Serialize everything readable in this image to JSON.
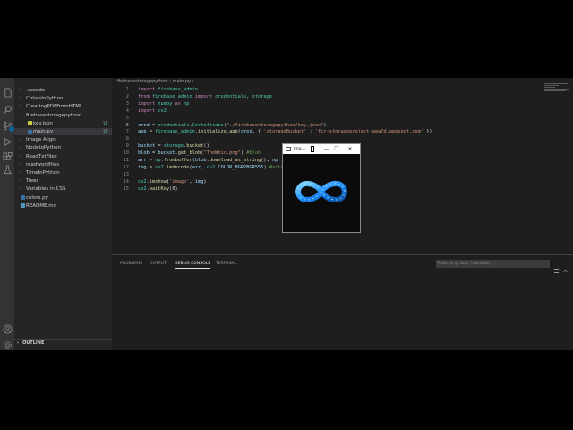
{
  "explorer": {
    "items": [
      {
        "label": ".vscode",
        "chevron": "›",
        "type": "folder"
      },
      {
        "label": "ColorsInPython",
        "chevron": "›",
        "type": "folder"
      },
      {
        "label": "CreatingPDFFromHTML",
        "chevron": "›",
        "type": "folder"
      },
      {
        "label": "firebasestoragepython",
        "chevron": "⌄",
        "type": "folder-open"
      },
      {
        "label": "key.json",
        "chevron": "",
        "type": "json",
        "status": "U"
      },
      {
        "label": "main.py",
        "chevron": "",
        "type": "py",
        "status": "U"
      },
      {
        "label": "Image Align",
        "chevron": "›",
        "type": "folder"
      },
      {
        "label": "NodetoPython",
        "chevron": "›",
        "type": "folder"
      },
      {
        "label": "ReadTxtFiles",
        "chevron": "›",
        "type": "folder"
      },
      {
        "label": "readwordfiles",
        "chevron": "›",
        "type": "folder"
      },
      {
        "label": "TimeInPython",
        "chevron": "›",
        "type": "folder"
      },
      {
        "label": "Trees",
        "chevron": "›",
        "type": "folder"
      },
      {
        "label": "Variables in CSS",
        "chevron": "›",
        "type": "folder"
      },
      {
        "label": "colors.py",
        "chevron": "",
        "type": "py"
      },
      {
        "label": "README.md",
        "chevron": "",
        "type": "md"
      }
    ],
    "outline_label": "OUTLINE"
  },
  "editor": {
    "breadcrumb": "firebasestoragepython › main.py › ...",
    "lines": [
      {
        "n": "1",
        "tokens": [
          [
            "kw",
            "import"
          ],
          [
            "plain",
            " "
          ],
          [
            "mod",
            "firebase_admin"
          ]
        ]
      },
      {
        "n": "2",
        "tokens": [
          [
            "kw",
            "from"
          ],
          [
            "plain",
            " "
          ],
          [
            "mod",
            "firebase_admin"
          ],
          [
            "plain",
            " "
          ],
          [
            "kw",
            "import"
          ],
          [
            "plain",
            " "
          ],
          [
            "mod",
            "credentials"
          ],
          [
            "plain",
            ", "
          ],
          [
            "mod",
            "storage"
          ]
        ]
      },
      {
        "n": "3",
        "tokens": [
          [
            "kw",
            "import"
          ],
          [
            "plain",
            " "
          ],
          [
            "mod",
            "numpy"
          ],
          [
            "plain",
            " "
          ],
          [
            "kw",
            "as"
          ],
          [
            "plain",
            " "
          ],
          [
            "mod",
            "np"
          ]
        ]
      },
      {
        "n": "4",
        "tokens": [
          [
            "kw",
            "import"
          ],
          [
            "plain",
            " "
          ],
          [
            "mod",
            "cv2"
          ]
        ]
      },
      {
        "n": "5",
        "tokens": []
      },
      {
        "n": "6",
        "tokens": [
          [
            "ident",
            "cred"
          ],
          [
            "plain",
            " = "
          ],
          [
            "mod",
            "credentials"
          ],
          [
            "plain",
            "."
          ],
          [
            "mod",
            "Certificate"
          ],
          [
            "plain",
            "("
          ],
          [
            "str",
            "\"./firebasestoragepython/key.json\""
          ],
          [
            "plain",
            ")"
          ]
        ]
      },
      {
        "n": "7",
        "tokens": [
          [
            "ident",
            "app"
          ],
          [
            "plain",
            " = "
          ],
          [
            "mod",
            "firebase_admin"
          ],
          [
            "plain",
            "."
          ],
          [
            "fn",
            "initialize_app"
          ],
          [
            "plain",
            "("
          ],
          [
            "ident",
            "cred"
          ],
          [
            "plain",
            ", { "
          ],
          [
            "str",
            "'storageBucket'"
          ],
          [
            "plain",
            " : "
          ],
          [
            "str",
            "'fir-storageproject-ama7d.appspot.com'"
          ],
          [
            "plain",
            " })"
          ]
        ]
      },
      {
        "n": "8",
        "tokens": []
      },
      {
        "n": "9",
        "tokens": [
          [
            "ident",
            "bucket"
          ],
          [
            "plain",
            " = "
          ],
          [
            "mod",
            "storage"
          ],
          [
            "plain",
            "."
          ],
          [
            "fn",
            "bucket"
          ],
          [
            "plain",
            "()"
          ]
        ]
      },
      {
        "n": "10",
        "tokens": [
          [
            "ident",
            "blob"
          ],
          [
            "plain",
            " = "
          ],
          [
            "ident",
            "bucket"
          ],
          [
            "plain",
            "."
          ],
          [
            "fn",
            "get_blob"
          ],
          [
            "plain",
            "("
          ],
          [
            "str",
            "\"TheWhic.png\""
          ],
          [
            "plain",
            ") "
          ],
          [
            "cmt",
            "#blob"
          ]
        ]
      },
      {
        "n": "11",
        "tokens": [
          [
            "ident",
            "arr"
          ],
          [
            "plain",
            " = "
          ],
          [
            "mod",
            "np"
          ],
          [
            "plain",
            "."
          ],
          [
            "fn",
            "frombuffer"
          ],
          [
            "plain",
            "("
          ],
          [
            "ident",
            "blob"
          ],
          [
            "plain",
            "."
          ],
          [
            "fn",
            "download_as_string"
          ],
          [
            "plain",
            "(), "
          ],
          [
            "ident",
            "np"
          ]
        ]
      },
      {
        "n": "12",
        "tokens": [
          [
            "ident",
            "img"
          ],
          [
            "plain",
            " = "
          ],
          [
            "mod",
            "cv2"
          ],
          [
            "plain",
            "."
          ],
          [
            "fn",
            "imdecode"
          ],
          [
            "plain",
            "("
          ],
          [
            "ident",
            "arr"
          ],
          [
            "plain",
            ", "
          ],
          [
            "mod",
            "cv2"
          ],
          [
            "plain",
            "."
          ],
          [
            "ident",
            "COLOR_BGR2BGR555"
          ],
          [
            "plain",
            ") "
          ],
          [
            "cmt",
            "#actu"
          ]
        ]
      },
      {
        "n": "13",
        "tokens": []
      },
      {
        "n": "14",
        "tokens": [
          [
            "mod",
            "cv2"
          ],
          [
            "plain",
            "."
          ],
          [
            "fn",
            "imshow"
          ],
          [
            "plain",
            "("
          ],
          [
            "str",
            "'image'"
          ],
          [
            "plain",
            ", "
          ],
          [
            "ident",
            "img"
          ],
          [
            "plain",
            ")"
          ]
        ]
      },
      {
        "n": "15",
        "tokens": [
          [
            "mod",
            "cv2"
          ],
          [
            "plain",
            "."
          ],
          [
            "fn",
            "waitKey"
          ],
          [
            "plain",
            "("
          ],
          [
            "plain",
            "0"
          ],
          [
            "plain",
            ")"
          ]
        ]
      }
    ]
  },
  "panel": {
    "tabs": [
      {
        "label": "PROBLEMS",
        "active": false
      },
      {
        "label": "OUTPUT",
        "active": false
      },
      {
        "label": "DEBUG CONSOLE",
        "active": true
      },
      {
        "label": "TERMINAL",
        "active": false
      }
    ],
    "filter_placeholder": "Filter (e.g. text, !exclude)"
  },
  "image_window": {
    "title": "ima...",
    "minimize": "—",
    "maximize": "☐",
    "close": "✕",
    "content_icon": "infinity-logo-icon"
  },
  "colors": {
    "accent": "#0e639c",
    "infinity_blue": "#1e90ff"
  }
}
